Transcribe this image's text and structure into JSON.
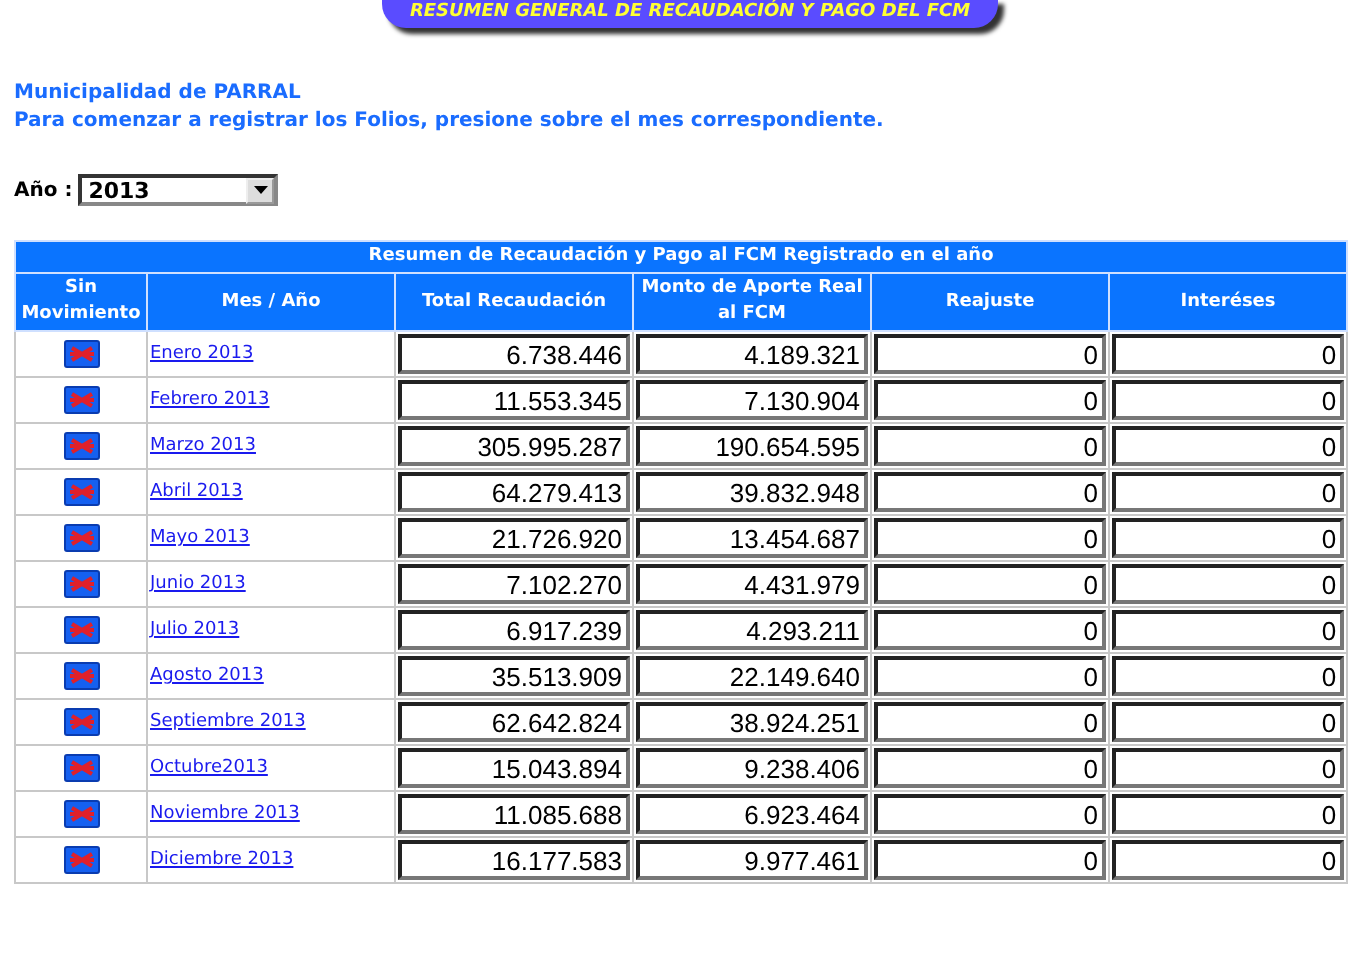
{
  "banner": {
    "title": "RESUMEN GENERAL DE RECAUDACIÓN Y PAGO DEL FCM"
  },
  "intro": [
    "Municipalidad de PARRAL",
    "Para comenzar a registrar los Folios, presione sobre el mes correspondiente."
  ],
  "year_select": {
    "label": "Año :",
    "value": "2013"
  },
  "table": {
    "caption": "Resumen de Recaudación y Pago al FCM Registrado en el año",
    "columns": [
      "Sin Movimiento",
      "Mes / Año",
      "Total Recaudación",
      "Monto de Aporte Real al FCM",
      "Reajuste",
      "Interéses"
    ],
    "rows": [
      {
        "month": "Enero 2013",
        "total": "6.738.446",
        "aporte": "4.189.321",
        "reajuste": "0",
        "intereses": "0"
      },
      {
        "month": "Febrero 2013",
        "total": "11.553.345",
        "aporte": "7.130.904",
        "reajuste": "0",
        "intereses": "0"
      },
      {
        "month": "Marzo 2013",
        "total": "305.995.287",
        "aporte": "190.654.595",
        "reajuste": "0",
        "intereses": "0"
      },
      {
        "month": "Abril 2013",
        "total": "64.279.413",
        "aporte": "39.832.948",
        "reajuste": "0",
        "intereses": "0"
      },
      {
        "month": "Mayo 2013",
        "total": "21.726.920",
        "aporte": "13.454.687",
        "reajuste": "0",
        "intereses": "0"
      },
      {
        "month": "Junio 2013",
        "total": "7.102.270",
        "aporte": "4.431.979",
        "reajuste": "0",
        "intereses": "0"
      },
      {
        "month": "Julio 2013",
        "total": "6.917.239",
        "aporte": "4.293.211",
        "reajuste": "0",
        "intereses": "0"
      },
      {
        "month": "Agosto 2013",
        "total": "35.513.909",
        "aporte": "22.149.640",
        "reajuste": "0",
        "intereses": "0"
      },
      {
        "month": "Septiembre 2013",
        "total": "62.642.824",
        "aporte": "38.924.251",
        "reajuste": "0",
        "intereses": "0"
      },
      {
        "month": "Octubre2013",
        "total": "15.043.894",
        "aporte": "9.238.406",
        "reajuste": "0",
        "intereses": "0"
      },
      {
        "month": "Noviembre 2013",
        "total": "11.085.688",
        "aporte": "6.923.464",
        "reajuste": "0",
        "intereses": "0"
      },
      {
        "month": "Diciembre 2013",
        "total": "16.177.583",
        "aporte": "9.977.461",
        "reajuste": "0",
        "intereses": "0"
      }
    ]
  }
}
